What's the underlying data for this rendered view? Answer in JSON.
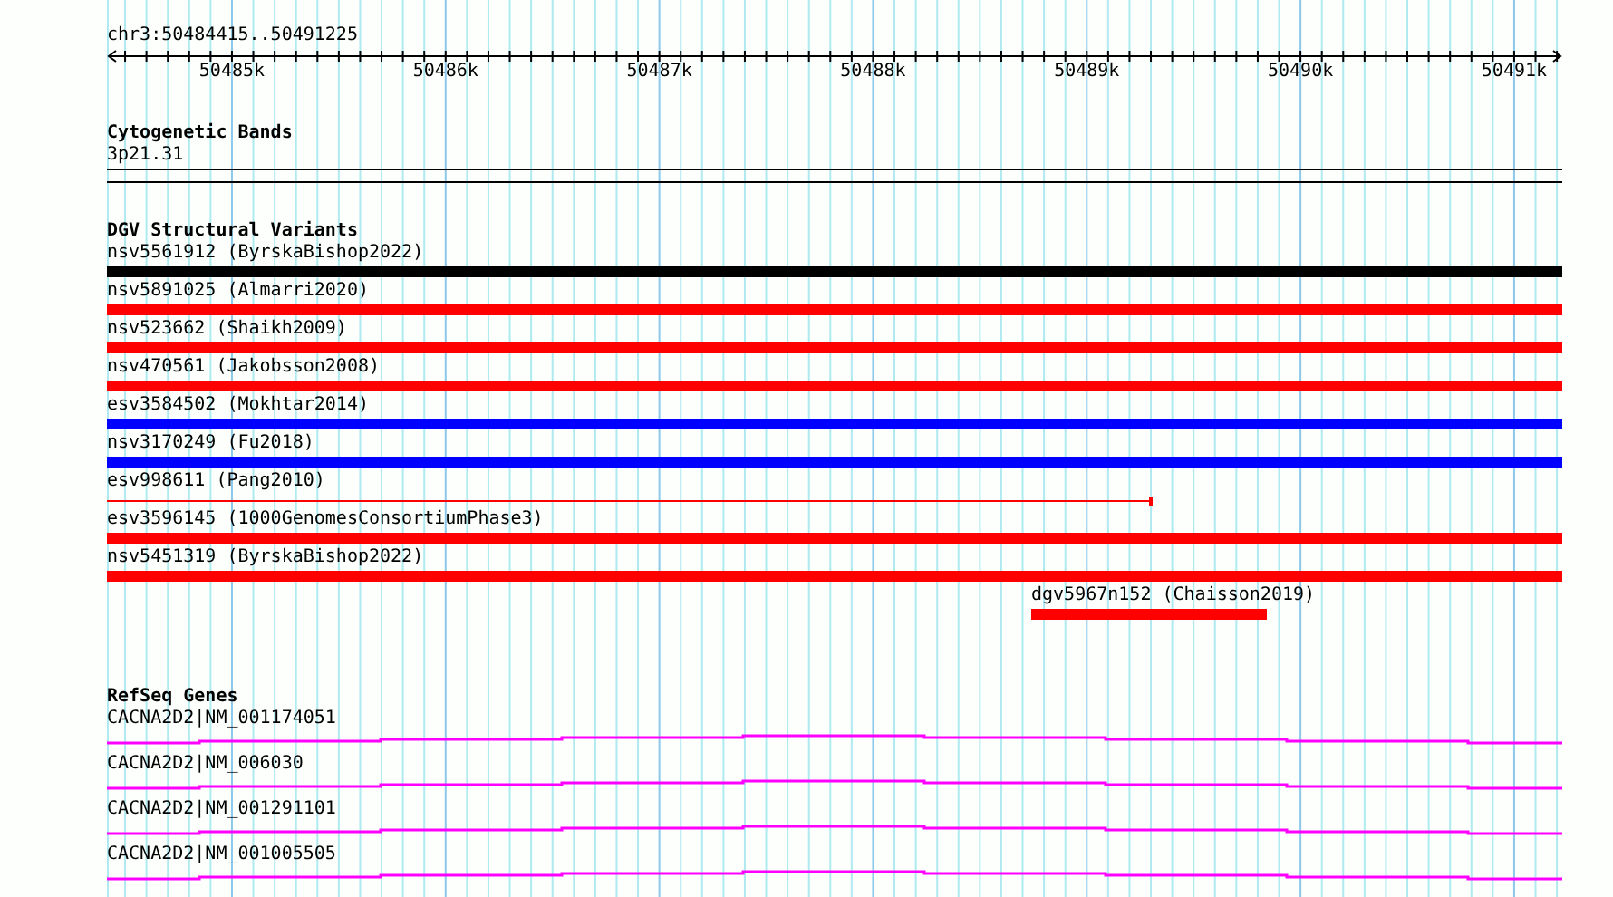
{
  "ruler": {
    "location": "chr3:50484415..50491225",
    "tick_labels": [
      "50485k",
      "50486k",
      "50487k",
      "50488k",
      "50489k",
      "50490k",
      "50491k"
    ]
  },
  "cytogenetic_bands": {
    "title": "Cytogenetic Bands",
    "band": "3p21.31"
  },
  "structural_variants": {
    "title": "DGV Structural Variants",
    "items": [
      {
        "label": "nsv5561912 (ByrskaBishop2022)",
        "color": "#000000",
        "kind": "bar"
      },
      {
        "label": "nsv5891025 (Almarri2020)",
        "color": "#ff0000",
        "kind": "bar"
      },
      {
        "label": "nsv523662 (Shaikh2009)",
        "color": "#ff0000",
        "kind": "bar"
      },
      {
        "label": "nsv470561 (Jakobsson2008)",
        "color": "#ff0000",
        "kind": "bar"
      },
      {
        "label": "esv3584502 (Mokhtar2014)",
        "color": "#0000ff",
        "kind": "bar"
      },
      {
        "label": "nsv3170249 (Fu2018)",
        "color": "#0000ff",
        "kind": "bar"
      },
      {
        "label": "esv998611 (Pang2010)",
        "color": "#ff0000",
        "kind": "line"
      },
      {
        "label": "esv3596145 (1000GenomesConsortiumPhase3)",
        "color": "#ff0000",
        "kind": "bar"
      },
      {
        "label": "nsv5451319 (ByrskaBishop2022)",
        "color": "#ff0000",
        "kind": "bar"
      },
      {
        "label": "dgv5967n152 (Chaisson2019)",
        "color": "#ff0000",
        "kind": "short-bar"
      }
    ]
  },
  "refseq_genes": {
    "title": "RefSeq Genes",
    "items": [
      {
        "label": "CACNA2D2|NM_001174051"
      },
      {
        "label": "CACNA2D2|NM_006030"
      },
      {
        "label": "CACNA2D2|NM_001291101"
      },
      {
        "label": "CACNA2D2|NM_001005505"
      }
    ]
  }
}
